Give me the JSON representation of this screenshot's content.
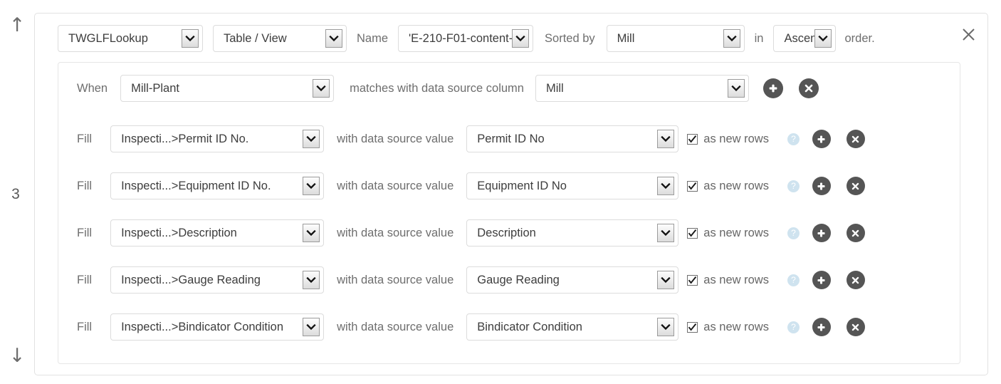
{
  "rail": {
    "up_arrow": "↑",
    "down_arrow": "↓",
    "step_number": "3"
  },
  "panel": {
    "close_label": "✕"
  },
  "header": {
    "source_value": "TWGLFLookup",
    "kind_value": "Table / View",
    "name_label": "Name",
    "name_value": "'E-210-F01-content-",
    "sorted_by_label": "Sorted by",
    "sort_column_value": "Mill",
    "in_label": "in",
    "order_value": "Ascen",
    "order_suffix_label": "order."
  },
  "when_row": {
    "when_label": "When",
    "when_value": "Mill-Plant",
    "matches_label": "matches with data source column",
    "column_value": "Mill",
    "add_label": "+",
    "remove_label": "✕"
  },
  "fill_rows": [
    {
      "fill_label": "Fill",
      "target_value": "Inspecti...>Permit ID No.",
      "with_label": "with data source value",
      "source_value": "Permit ID No",
      "as_new_rows_label": "as new rows",
      "as_new_rows_checked": true,
      "help_label": "?",
      "add_label": "+",
      "remove_label": "✕"
    },
    {
      "fill_label": "Fill",
      "target_value": "Inspecti...>Equipment ID No.",
      "with_label": "with data source value",
      "source_value": "Equipment ID No",
      "as_new_rows_label": "as new rows",
      "as_new_rows_checked": true,
      "help_label": "?",
      "add_label": "+",
      "remove_label": "✕"
    },
    {
      "fill_label": "Fill",
      "target_value": "Inspecti...>Description",
      "with_label": "with data source value",
      "source_value": "Description",
      "as_new_rows_label": "as new rows",
      "as_new_rows_checked": true,
      "help_label": "?",
      "add_label": "+",
      "remove_label": "✕"
    },
    {
      "fill_label": "Fill",
      "target_value": "Inspecti...>Gauge Reading",
      "with_label": "with data source value",
      "source_value": "Gauge Reading",
      "as_new_rows_label": "as new rows",
      "as_new_rows_checked": true,
      "help_label": "?",
      "add_label": "+",
      "remove_label": "✕"
    },
    {
      "fill_label": "Fill",
      "target_value": "Inspecti...>Bindicator Condition",
      "with_label": "with data source value",
      "source_value": "Bindicator Condition",
      "as_new_rows_label": "as new rows",
      "as_new_rows_checked": true,
      "help_label": "?",
      "add_label": "+",
      "remove_label": "✕"
    }
  ],
  "colors": {
    "page_background": "#ffffff",
    "panel_border": "#e2e2e2",
    "label_text": "#6e6e6e",
    "value_text": "#3d3d3d",
    "action_button": "#555555",
    "help_icon": "#cfe3ef",
    "rail_icon": "#6d6d6d"
  }
}
